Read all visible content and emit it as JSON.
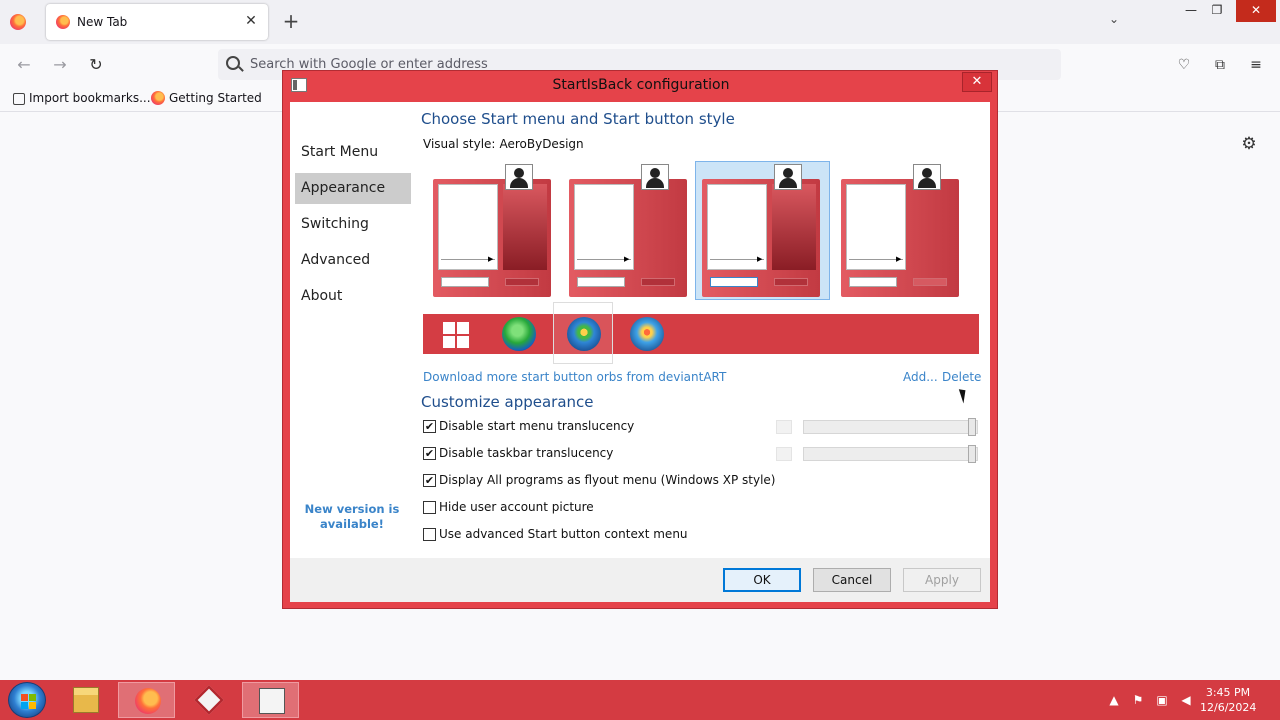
{
  "browser": {
    "tab_title": "New Tab",
    "address_placeholder": "Search with Google or enter address",
    "bookmarks": [
      "Import bookmarks...",
      "Getting Started"
    ],
    "icons": [
      "firefox-view-icon",
      "tab-close-icon",
      "new-tab-icon",
      "list-all-tabs-icon",
      "minimize-icon",
      "restore-icon",
      "close-icon",
      "back-icon",
      "forward-icon",
      "reload-icon",
      "search-icon",
      "pocket-icon",
      "extensions-icon",
      "menu-icon",
      "settings-gear-icon"
    ]
  },
  "dialog": {
    "title": "StartIsBack configuration",
    "sidebar": [
      "Start Menu",
      "Appearance",
      "Switching",
      "Advanced",
      "About"
    ],
    "active_sidebar": "Appearance",
    "new_version": "New version is available!",
    "heading": "Choose Start menu and Start button style",
    "visual_style_label": "Visual style:",
    "visual_style_value": "AeroByDesign",
    "selected_style_index": 2,
    "selected_orb_index": 2,
    "download_link": "Download more start button orbs from deviantART",
    "add_link": "Add...",
    "delete_link": "Delete",
    "customize_heading": "Customize appearance",
    "options": [
      {
        "label": "Disable start menu translucency",
        "checked": true
      },
      {
        "label": "Disable taskbar translucency",
        "checked": true
      },
      {
        "label": "Display All programs as flyout menu (Windows XP style)",
        "checked": true
      },
      {
        "label": "Hide user account picture",
        "checked": false
      },
      {
        "label": "Use advanced Start button context menu",
        "checked": false
      }
    ],
    "buttons": {
      "ok": "OK",
      "cancel": "Cancel",
      "apply": "Apply"
    }
  },
  "taskbar": {
    "time": "3:45 PM",
    "date": "12/6/2024",
    "accent": "#d43b42"
  },
  "colors": {
    "dialog_frame": "#e5434a",
    "heading": "#1f4e8c",
    "link": "#3a84c9"
  }
}
